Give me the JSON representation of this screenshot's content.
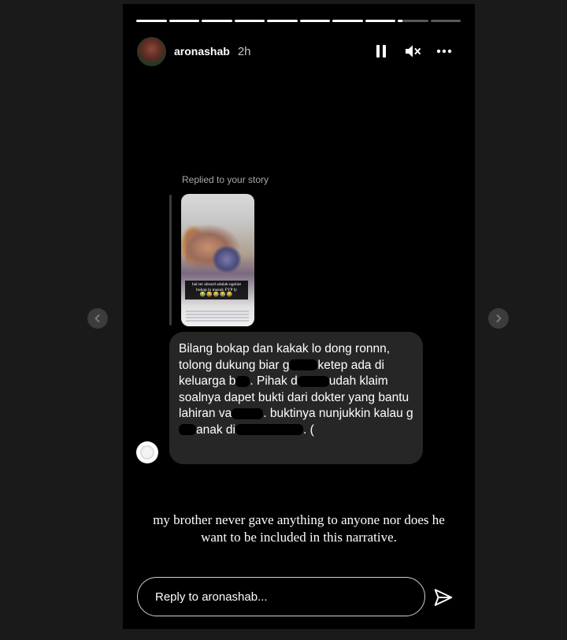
{
  "story": {
    "progress": {
      "segments_total": 10,
      "segments_complete": 8,
      "current_fraction": 0.15
    },
    "header": {
      "username": "aronashab",
      "time_ago": "2h",
      "icons": [
        "pause-icon",
        "mute-icon",
        "more-icon"
      ]
    },
    "reply_context": {
      "label": "Replied to your story"
    },
    "thumbnail": {
      "caption": "hal ter absurd adalah ngeliat bokap lo masuk FYP ly",
      "emoji": "😂😂😂😂😂"
    },
    "message": {
      "p1": "Bilang bokap dan kakak lo dong ronnn, tolong dukung biar g",
      "p2": "ketep ada di keluarga b",
      "p3": ". Pihak d",
      "p4": "udah klaim soalnya dapet bukti dari dokter yang bantu lahiran va",
      "p5": ". buktinya nunjukkin kalau g",
      "p6": "anak di",
      "p7": ". ("
    },
    "caption": "my brother never gave anything to anyone nor does he want to be included in this narrative.",
    "reply_input": {
      "placeholder": "Reply to aronashab..."
    }
  },
  "colors": {
    "story_bg": "#000000",
    "page_bg": "#1a1a1a",
    "bubble_bg": "#262626",
    "text": "#ffffff"
  }
}
